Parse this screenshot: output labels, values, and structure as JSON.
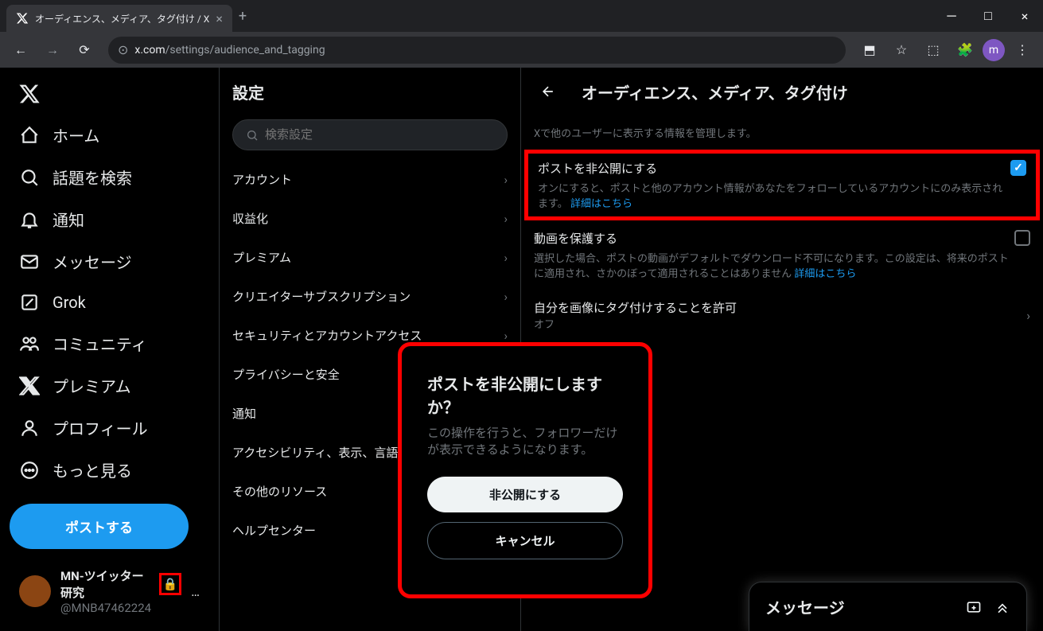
{
  "browser": {
    "tab_title": "オーディエンス、メディア、タグ付け / X",
    "url_domain": "x.com",
    "url_path": "/settings/audience_and_tagging",
    "avatar_letter": "m"
  },
  "sidebar": {
    "items": [
      {
        "label": "ホーム"
      },
      {
        "label": "話題を検索"
      },
      {
        "label": "通知"
      },
      {
        "label": "メッセージ"
      },
      {
        "label": "Grok"
      },
      {
        "label": "コミュニティ"
      },
      {
        "label": "プレミアム"
      },
      {
        "label": "プロフィール"
      },
      {
        "label": "もっと見る"
      }
    ],
    "post_button": "ポストする",
    "user": {
      "name": "MN-ツイッター研究",
      "handle": "@MNB47462224"
    }
  },
  "settings": {
    "title": "設定",
    "search_placeholder": "検索設定",
    "items": [
      {
        "label": "アカウント"
      },
      {
        "label": "収益化"
      },
      {
        "label": "プレミアム"
      },
      {
        "label": "クリエイターサブスクリプション"
      },
      {
        "label": "セキュリティとアカウントアクセス"
      },
      {
        "label": "プライバシーと安全"
      },
      {
        "label": "通知"
      },
      {
        "label": "アクセシビリティ、表示、言語"
      },
      {
        "label": "その他のリソース"
      },
      {
        "label": "ヘルプセンター"
      }
    ]
  },
  "detail": {
    "title": "オーディエンス、メディア、タグ付け",
    "description": "Xで他のユーザーに表示する情報を管理します。",
    "protect_posts": {
      "label": "ポストを非公開にする",
      "description": "オンにすると、ポストと他のアカウント情報があなたをフォローしているアカウントにのみ表示されます。 ",
      "link": "詳細はこちら",
      "checked": true
    },
    "protect_videos": {
      "label": "動画を保護する",
      "description": "選択した場合、ポストの動画がデフォルトでダウンロード不可になります。この設定は、将来のポストに適用され、さかのぼって適用されることはありません ",
      "link": "詳細はこちら",
      "checked": false
    },
    "photo_tagging": {
      "label": "自分を画像にタグ付けすることを許可",
      "value": "オフ"
    }
  },
  "modal": {
    "title": "ポストを非公開にしますか？",
    "text": "この操作を行うと、フォロワーだけが表示できるようになります。",
    "confirm": "非公開にする",
    "cancel": "キャンセル"
  },
  "messages": {
    "title": "メッセージ"
  }
}
